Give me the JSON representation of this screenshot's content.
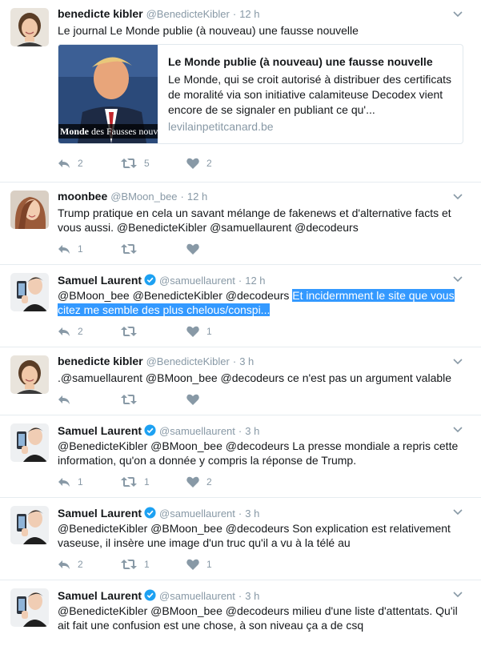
{
  "colors": {
    "accent": "#1da1f2",
    "meta": "#8899a6",
    "highlight": "#3399ff"
  },
  "tweets": [
    {
      "fullname": "benedicte kibler",
      "username": "@BenedicteKibler",
      "time": "12 h",
      "verified": false,
      "avatar": "woman-short-hair-avatar",
      "text": "Le journal Le Monde publie (à nouveau) une fausse nouvelle",
      "card": {
        "title": "Le Monde publie (à nouveau) une fausse nouvelle",
        "description": "Le Monde, qui se croit autorisé à distribuer des certificats de moralité via son initiative calamiteuse Decodex vient encore de se signaler en publiant ce qu'...",
        "domain": "levilainpetitcanard.be",
        "image_caption_bold": "Monde",
        "image_caption": " des Fausses nouve"
      },
      "replies": "2",
      "retweets": "5",
      "likes": "2"
    },
    {
      "fullname": "moonbee",
      "username": "@BMoon_bee",
      "time": "12 h",
      "verified": false,
      "avatar": "woman-long-hair-avatar",
      "text": "Trump pratique en cela un savant mélange de fakenews et d'alternative facts et vous aussi.  @BenedicteKibler  @samuellaurent @decodeurs",
      "replies": "1",
      "retweets": "",
      "likes": ""
    },
    {
      "fullname": "Samuel Laurent",
      "username": "@samuellaurent",
      "time": "12 h",
      "verified": true,
      "avatar": "man-phone-selfie-avatar",
      "text": "@BMoon_bee @BenedicteKibler @decodeurs ",
      "text_highlight": "Et incidermment le site que vous citez me semble des plus chelous/conspi...",
      "replies": "2",
      "retweets": "",
      "likes": "1"
    },
    {
      "fullname": "benedicte kibler",
      "username": "@BenedicteKibler",
      "time": "3 h",
      "verified": false,
      "avatar": "woman-short-hair-avatar",
      "text": ".@samuellaurent @BMoon_bee @decodeurs ce n'est pas un argument valable",
      "replies": "",
      "retweets": "",
      "likes": ""
    },
    {
      "fullname": "Samuel Laurent",
      "username": "@samuellaurent",
      "time": "3 h",
      "verified": true,
      "avatar": "man-phone-selfie-avatar",
      "text": "@BenedicteKibler @BMoon_bee @decodeurs La presse mondiale a repris cette information, qu'on a donnée y compris la réponse de Trump.",
      "replies": "1",
      "retweets": "1",
      "likes": "2"
    },
    {
      "fullname": "Samuel Laurent",
      "username": "@samuellaurent",
      "time": "3 h",
      "verified": true,
      "avatar": "man-phone-selfie-avatar",
      "text": "@BenedicteKibler @BMoon_bee @decodeurs Son explication est relativement vaseuse, il insère une image d'un truc qu'il a vu à la télé au",
      "replies": "2",
      "retweets": "1",
      "likes": "1"
    },
    {
      "fullname": "Samuel Laurent",
      "username": "@samuellaurent",
      "time": "3 h",
      "verified": true,
      "avatar": "man-phone-selfie-avatar",
      "text": "@BenedicteKibler @BMoon_bee @decodeurs milieu d'une liste d'attentats. Qu'il ait fait une confusion est une chose, à son niveau ça a de csq",
      "replies": "",
      "retweets": "",
      "likes": ""
    }
  ]
}
